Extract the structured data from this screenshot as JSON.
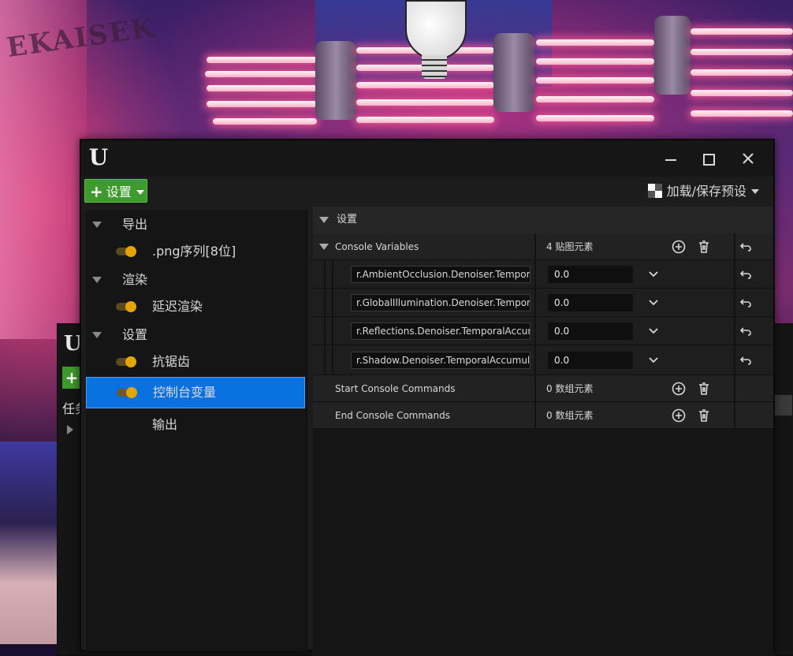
{
  "background_window": {
    "task_label": "任务"
  },
  "toolbar": {
    "add_label": "设置",
    "presets_label": "加载/保存预设"
  },
  "tree": [
    {
      "label": "导出",
      "type": "category"
    },
    {
      "label": ".png序列[8位]",
      "type": "leaf",
      "enabled": true
    },
    {
      "label": "渲染",
      "type": "category"
    },
    {
      "label": "延迟渲染",
      "type": "leaf",
      "enabled": true
    },
    {
      "label": "设置",
      "type": "category"
    },
    {
      "label": "抗锯齿",
      "type": "leaf",
      "enabled": true
    },
    {
      "label": "控制台变量",
      "type": "leaf",
      "enabled": true,
      "selected": true
    },
    {
      "label": "输出",
      "type": "leaf-plain"
    }
  ],
  "details": {
    "section_title": "设置",
    "console_variables": {
      "label": "Console Variables",
      "count_label": "4 贴图元素",
      "entries": [
        {
          "key": "r.AmbientOcclusion.Denoiser.TemporalAccumulation",
          "value": "0.0"
        },
        {
          "key": "r.GlobalIllumination.Denoiser.TemporalAccumulation",
          "value": "0.0"
        },
        {
          "key": "r.Reflections.Denoiser.TemporalAccumulation",
          "value": "0.0"
        },
        {
          "key": "r.Shadow.Denoiser.TemporalAccumulation",
          "value": "0.0"
        }
      ]
    },
    "start_commands": {
      "label": "Start Console Commands",
      "count_label": "0 数组元素"
    },
    "end_commands": {
      "label": "End Console Commands",
      "count_label": "0 数组元素"
    }
  },
  "colors": {
    "accent_green": "#3e9a2c",
    "selection_blue": "#0a72e0",
    "toggle_orange": "#e6a400"
  }
}
